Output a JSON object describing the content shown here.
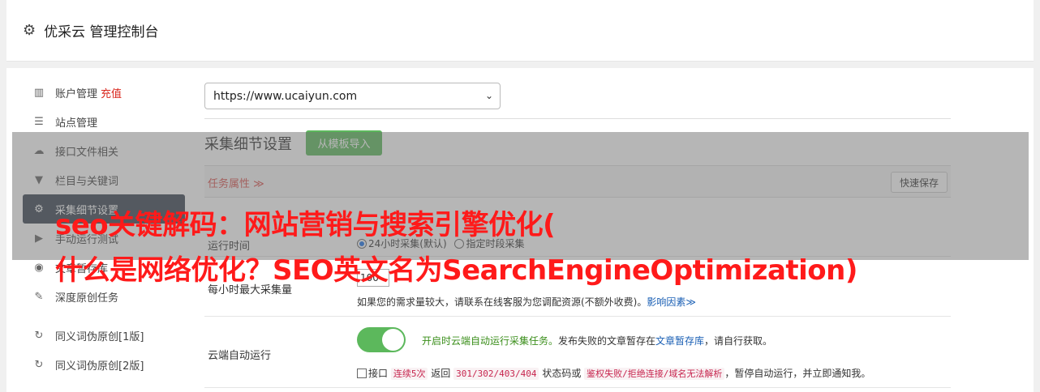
{
  "header": {
    "title": "优采云 管理控制台",
    "icon": "gear-icon"
  },
  "sidebar": {
    "account": {
      "label": "账户管理",
      "recharge": "充值",
      "icon": "bar-chart-icon"
    },
    "items": [
      {
        "label": "站点管理",
        "icon": "server-icon"
      },
      {
        "label": "接口文件相关",
        "icon": "cloud-upload-icon"
      },
      {
        "label": "栏目与关键词",
        "icon": "filter-icon"
      },
      {
        "label": "采集细节设置",
        "icon": "cogs-icon",
        "active": true
      },
      {
        "label": "手动运行测试",
        "icon": "play-circle-icon"
      },
      {
        "label": "文章暂存库",
        "icon": "database-icon"
      },
      {
        "label": "深度原创任务",
        "icon": "edit-icon"
      }
    ],
    "items2": [
      {
        "label": "同义词伪原创[1版]",
        "icon": "refresh-icon"
      },
      {
        "label": "同义词伪原创[2版]",
        "icon": "refresh-icon"
      }
    ]
  },
  "main": {
    "site_select": {
      "value": "https://www.ucaiyun.com"
    },
    "section_title": "采集细节设置",
    "template_button": "从模板导入",
    "tab_label": "任务属性 ≫",
    "quick_save": "快速保存",
    "rows": {
      "run_time": {
        "label": "运行时间",
        "option_24h": "24小时采集(默认)",
        "option_period": "指定时段采集"
      },
      "hourly_max": {
        "label": "每小时最大采集量",
        "value": "100",
        "note": "如果您的需求量较大，请联系在线客服为您调配资源(不额外收费)。",
        "factors_link": "影响因素≫"
      },
      "cloud_auto": {
        "label": "云端自动运行",
        "enabled_text": "开启时云端自动运行采集任务。",
        "failed_text": "发布失败的文章暂存在",
        "store_link": "文章暂存库",
        "fetch_text": "，请自行获取。",
        "check_prefix": "接口",
        "code1": "连续5次",
        "mid1": "返回",
        "code2": "301/302/403/404",
        "mid2": "状态码或",
        "code3": "鉴权失败/拒绝连接/域名无法解析",
        "suffix": "，暂停自动运行，并立即通知我。"
      }
    }
  },
  "overlay": {
    "line1": "seo关键解码：网站营销与搜索引擎优化(",
    "line2": "什么是网络优化？SEO英文名为SearchEngineOptimization)"
  }
}
